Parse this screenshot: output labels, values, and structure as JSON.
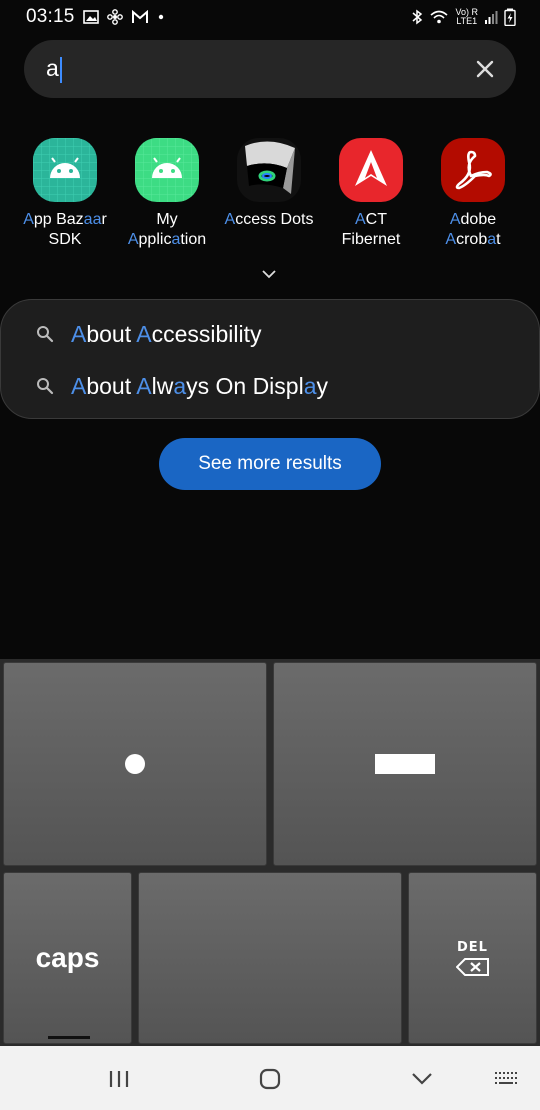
{
  "status_bar": {
    "time": "03:15",
    "signal_label_top": "Vo) R",
    "signal_label_bottom": "LTE1"
  },
  "search": {
    "query": "a"
  },
  "apps": [
    {
      "name_parts": [
        [
          "A",
          "h"
        ],
        [
          "pp Baz",
          ""
        ],
        [
          "aa",
          "h"
        ],
        [
          "r\n",
          ""
        ],
        [
          "SDK",
          ""
        ]
      ],
      "icon": "android-teal"
    },
    {
      "name_parts": [
        [
          "My\n",
          ""
        ],
        [
          "A",
          "h"
        ],
        [
          "pplic",
          ""
        ],
        [
          "a",
          "h"
        ],
        [
          "tion",
          ""
        ]
      ],
      "icon": "android-green"
    },
    {
      "name_parts": [
        [
          "A",
          "h"
        ],
        [
          "ccess Dots",
          ""
        ]
      ],
      "icon": "access-dots"
    },
    {
      "name_parts": [
        [
          "A",
          "h"
        ],
        [
          "CT\nFibernet",
          ""
        ]
      ],
      "icon": "act-fibernet"
    },
    {
      "name_parts": [
        [
          "A",
          "h"
        ],
        [
          "dobe\n",
          ""
        ],
        [
          "A",
          "h"
        ],
        [
          "crob",
          ""
        ],
        [
          "a",
          "h"
        ],
        [
          "t",
          ""
        ]
      ],
      "icon": "adobe-acrobat"
    }
  ],
  "suggestions": [
    {
      "parts": [
        [
          "A",
          "h"
        ],
        [
          "bout ",
          ""
        ],
        [
          "A",
          "h"
        ],
        [
          "ccessibility",
          ""
        ]
      ]
    },
    {
      "parts": [
        [
          "A",
          "h"
        ],
        [
          "bout ",
          ""
        ],
        [
          "A",
          "h"
        ],
        [
          "lw",
          ""
        ],
        [
          "a",
          "h"
        ],
        [
          "ys On Displ",
          ""
        ],
        [
          "a",
          "h"
        ],
        [
          "y",
          ""
        ]
      ]
    }
  ],
  "see_more_label": "See more results",
  "keypad": {
    "caps_label": "caps",
    "del_label": "DEL"
  },
  "colors": {
    "highlight": "#4d8fe8",
    "button": "#1a66c4"
  }
}
